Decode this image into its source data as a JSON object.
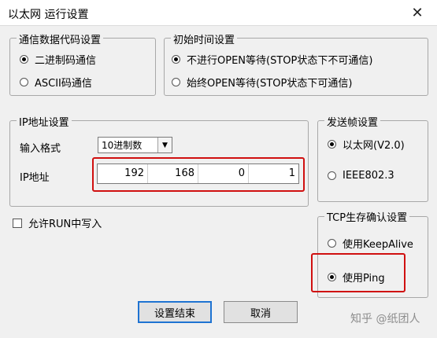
{
  "window": {
    "title": "以太网 运行设置",
    "close_glyph": "✕"
  },
  "comm_code": {
    "legend": "通信数据代码设置",
    "options": [
      {
        "label": "二进制码通信",
        "selected": true
      },
      {
        "label": "ASCII码通信",
        "selected": false
      }
    ]
  },
  "init_time": {
    "legend": "初始时间设置",
    "options": [
      {
        "label": "不进行OPEN等待(STOP状态下不可通信)",
        "selected": true
      },
      {
        "label": "始终OPEN等待(STOP状态下可通信)",
        "selected": false
      }
    ]
  },
  "ip_settings": {
    "legend": "IP地址设置",
    "format_label": "输入格式",
    "format_value": "10进制数",
    "address_label": "IP地址",
    "octets": [
      "192",
      "168",
      "0",
      "1"
    ]
  },
  "send_frame": {
    "legend": "发送帧设置",
    "options": [
      {
        "label": "以太网(V2.0)",
        "selected": true
      },
      {
        "label": "IEEE802.3",
        "selected": false
      }
    ]
  },
  "tcp_confirm": {
    "legend": "TCP生存确认设置",
    "options": [
      {
        "label": "使用KeepAlive",
        "selected": false
      },
      {
        "label": "使用Ping",
        "selected": true
      }
    ]
  },
  "run_write": {
    "label": "允许RUN中写入",
    "checked": false
  },
  "buttons": {
    "ok": "设置结束",
    "cancel": "取消"
  },
  "watermark": "知乎 @纸团人",
  "colors": {
    "highlight": "#d01010",
    "default_button_border": "#1e73d2"
  }
}
